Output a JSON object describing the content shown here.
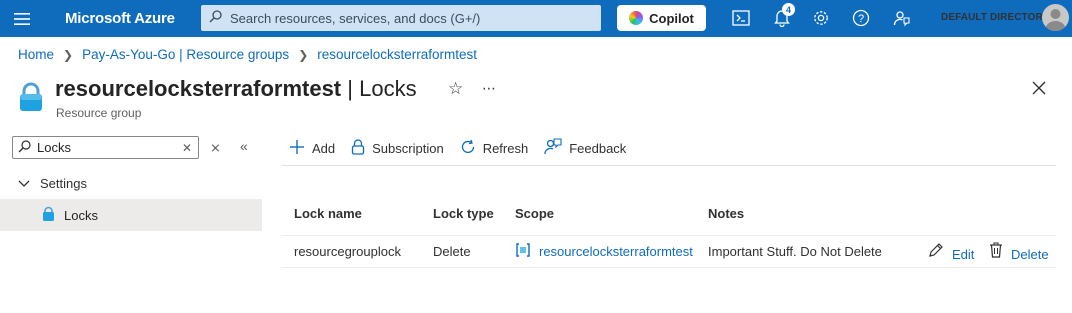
{
  "topbar": {
    "brand": "Microsoft Azure",
    "search_placeholder": "Search resources, services, and docs (G+/)",
    "copilot_label": "Copilot",
    "notification_count": "4",
    "directory": "DEFAULT DIRECTORY",
    "color": "#0f6cbd"
  },
  "breadcrumb": {
    "items": [
      "Home",
      "Pay-As-You-Go | Resource groups",
      "resourcelocksterraformtest"
    ]
  },
  "page": {
    "resource_name": "resourcelocksterraformtest",
    "section": "| Locks",
    "subtitle": "Resource group"
  },
  "nav": {
    "search_value": "Locks",
    "group_label": "Settings",
    "item_label": "Locks"
  },
  "toolbar": {
    "add": "Add",
    "subscription": "Subscription",
    "refresh": "Refresh",
    "feedback": "Feedback"
  },
  "table": {
    "headers": [
      "Lock name",
      "Lock type",
      "Scope",
      "Notes"
    ],
    "rows": [
      {
        "lock_name": "resourcegrouplock",
        "lock_type": "Delete",
        "scope": "resourcelocksterraformtest",
        "notes": "Important Stuff. Do Not Delete",
        "edit": "Edit",
        "delete": "Delete"
      }
    ]
  },
  "icons": [
    "hamburger-icon",
    "search-icon",
    "copilot-icon",
    "cloud-shell-icon",
    "bell-icon",
    "gear-icon",
    "help-icon",
    "feedback-person-icon",
    "lock-icon",
    "star-icon",
    "close-icon",
    "plus-icon",
    "refresh-icon",
    "pencil-icon",
    "trash-icon",
    "resource-group-icon"
  ]
}
